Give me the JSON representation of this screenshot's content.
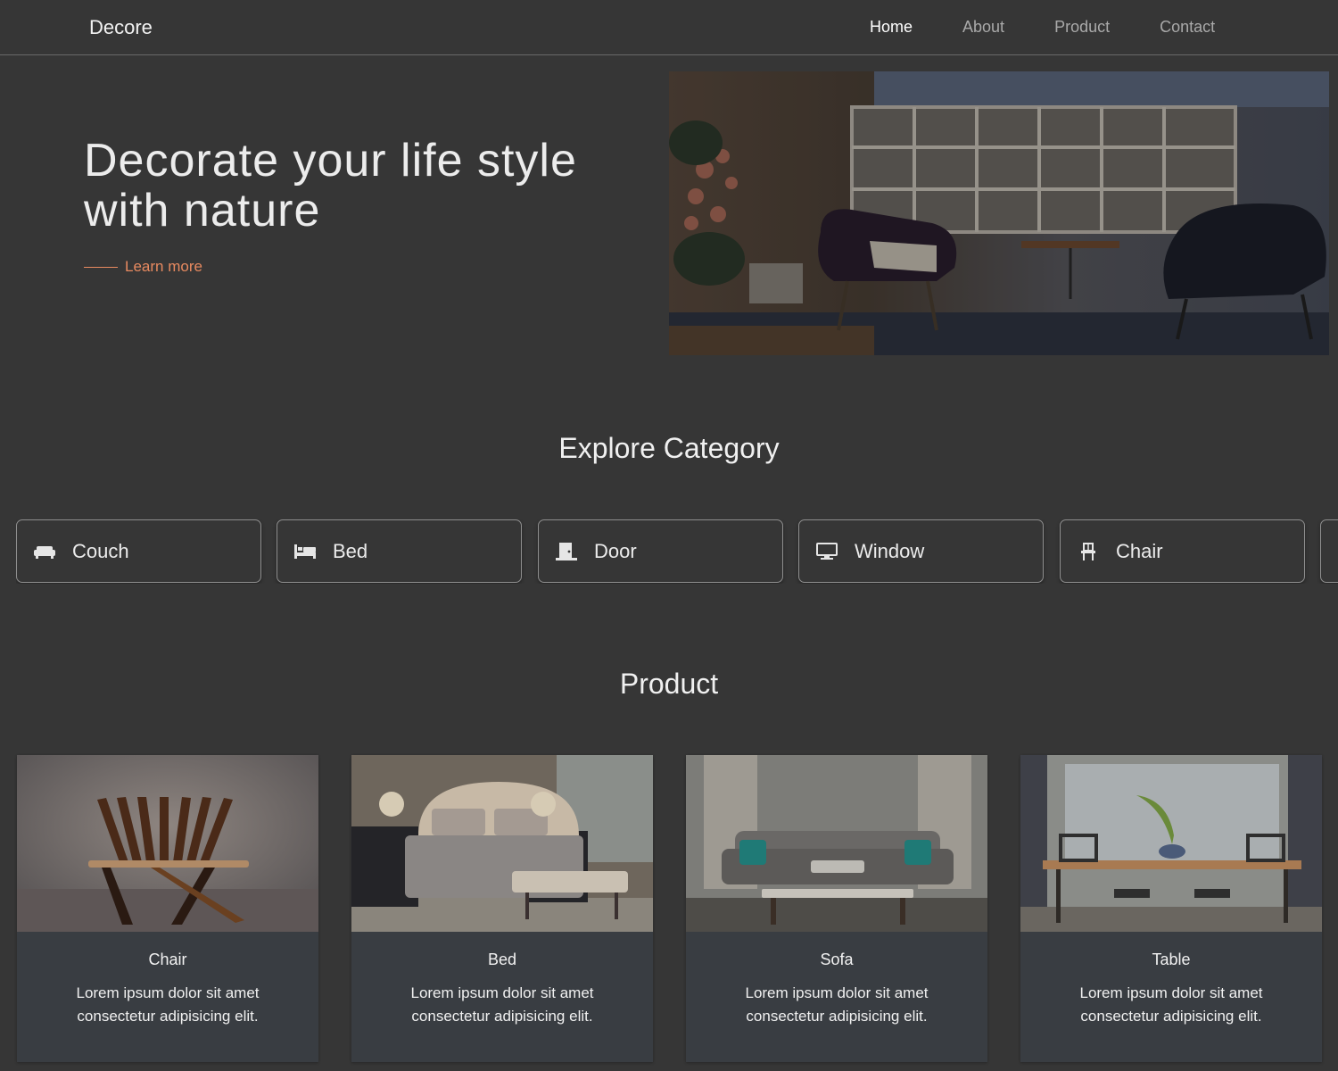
{
  "nav": {
    "brand": "Decore",
    "links": [
      "Home",
      "About",
      "Product",
      "Contact"
    ]
  },
  "hero": {
    "title": "Decorate your life style with nature",
    "cta": "Learn more",
    "image_icon": "living-room-photo"
  },
  "categories": {
    "title": "Explore Category",
    "items": [
      {
        "label": "Couch",
        "icon": "couch-icon"
      },
      {
        "label": "Bed",
        "icon": "bed-icon"
      },
      {
        "label": "Door",
        "icon": "door-icon"
      },
      {
        "label": "Window",
        "icon": "window-icon"
      },
      {
        "label": "Chair",
        "icon": "chair-icon"
      }
    ]
  },
  "products": {
    "title": "Product",
    "items": [
      {
        "name": "Chair",
        "desc": "Lorem ipsum dolor sit amet consectetur adipisicing elit."
      },
      {
        "name": "Bed",
        "desc": "Lorem ipsum dolor sit amet consectetur adipisicing elit."
      },
      {
        "name": "Sofa",
        "desc": "Lorem ipsum dolor sit amet consectetur adipisicing elit."
      },
      {
        "name": "Table",
        "desc": "Lorem ipsum dolor sit amet consectetur adipisicing elit."
      }
    ]
  },
  "colors": {
    "background": "#363636",
    "accent": "#e88a60",
    "card": "#393d42"
  }
}
